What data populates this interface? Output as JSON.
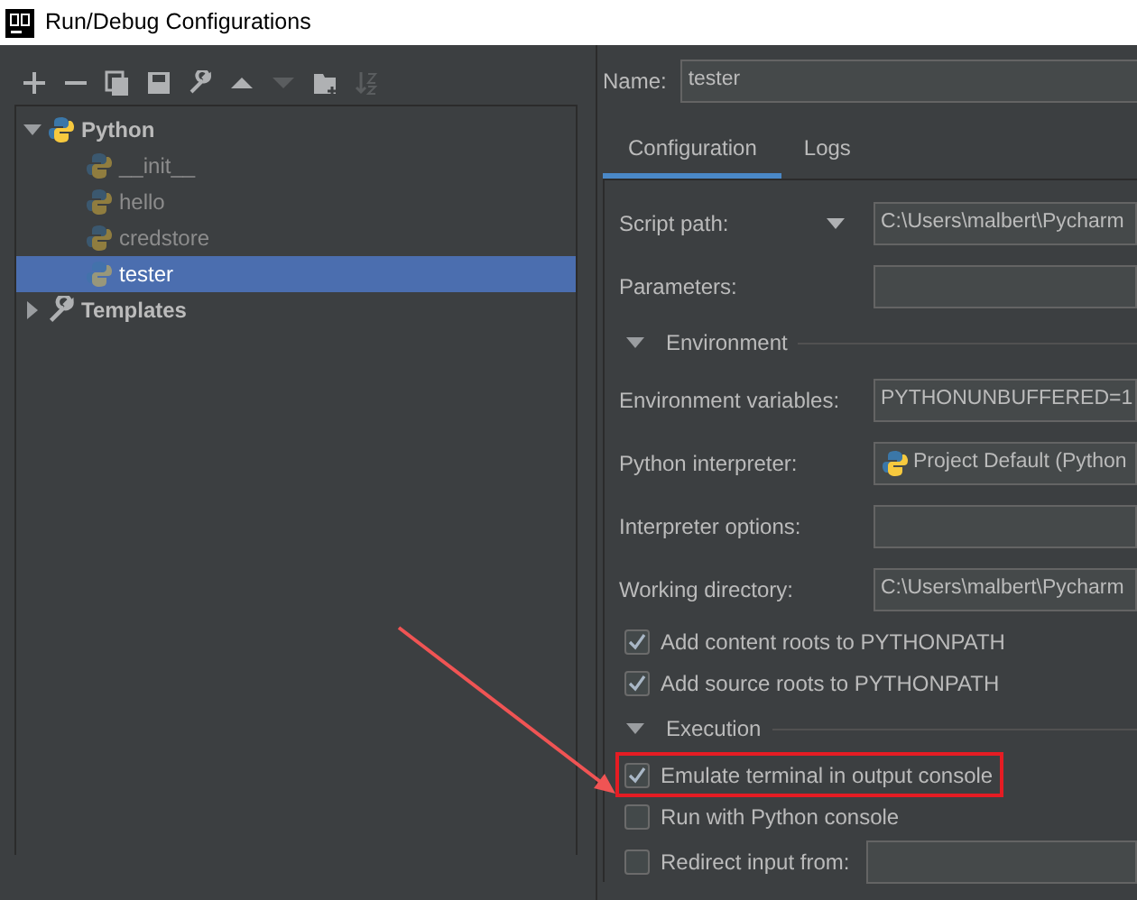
{
  "window": {
    "title": "Run/Debug Configurations"
  },
  "toolbar": [
    {
      "kind": "add",
      "disabled": false
    },
    {
      "kind": "remove",
      "disabled": false
    },
    {
      "kind": "copy",
      "disabled": false
    },
    {
      "kind": "save",
      "disabled": false
    },
    {
      "kind": "wrench",
      "disabled": false
    },
    {
      "kind": "up",
      "disabled": false
    },
    {
      "kind": "down",
      "disabled": true
    },
    {
      "kind": "folder",
      "disabled": false
    },
    {
      "kind": "sort",
      "disabled": true
    }
  ],
  "tree": [
    {
      "label": "Python",
      "kind": "python",
      "expanded": true,
      "selected": false,
      "children": [
        {
          "label": "__init__",
          "kind": "python",
          "selected": false
        },
        {
          "label": "hello",
          "kind": "python",
          "selected": false
        },
        {
          "label": "credstore",
          "kind": "python",
          "selected": false
        },
        {
          "label": "tester",
          "kind": "python",
          "selected": true
        }
      ]
    },
    {
      "label": "Templates",
      "kind": "wrench",
      "expanded": false,
      "selected": false
    }
  ],
  "name_field": {
    "label": "Name:",
    "value": "tester"
  },
  "tabs": [
    {
      "label": "Configuration",
      "selected": true
    },
    {
      "label": "Logs",
      "selected": false
    }
  ],
  "form": [
    {
      "kind": "dropdown",
      "label": "Script path:",
      "value": "C:\\Users\\malbert\\Pycharm"
    },
    {
      "kind": "field",
      "label": "Parameters:"
    },
    {
      "kind": "section",
      "label": "Environment"
    },
    {
      "kind": "field",
      "label": "Environment variables:",
      "value": "PYTHONUNBUFFERED=1"
    },
    {
      "kind": "interpreter",
      "label": "Python interpreter:",
      "value": "Project Default (Python"
    },
    {
      "kind": "field",
      "label": "Interpreter options:"
    },
    {
      "kind": "field",
      "label": "Working directory:",
      "value": "C:\\Users\\malbert\\Pycharm"
    },
    {
      "kind": "checkbox",
      "label": "Add content roots to PYTHONPATH",
      "checked": true
    },
    {
      "kind": "checkbox",
      "label": "Add source roots to PYTHONPATH",
      "checked": true
    },
    {
      "kind": "section",
      "label": "Execution"
    },
    {
      "kind": "checkbox",
      "label": "Emulate terminal in output console",
      "checked": true,
      "highlighted": true
    },
    {
      "kind": "checkbox",
      "label": "Run with Python console",
      "checked": false
    },
    {
      "kind": "checkbox-field",
      "label": "Redirect input from:",
      "checked": false
    }
  ]
}
